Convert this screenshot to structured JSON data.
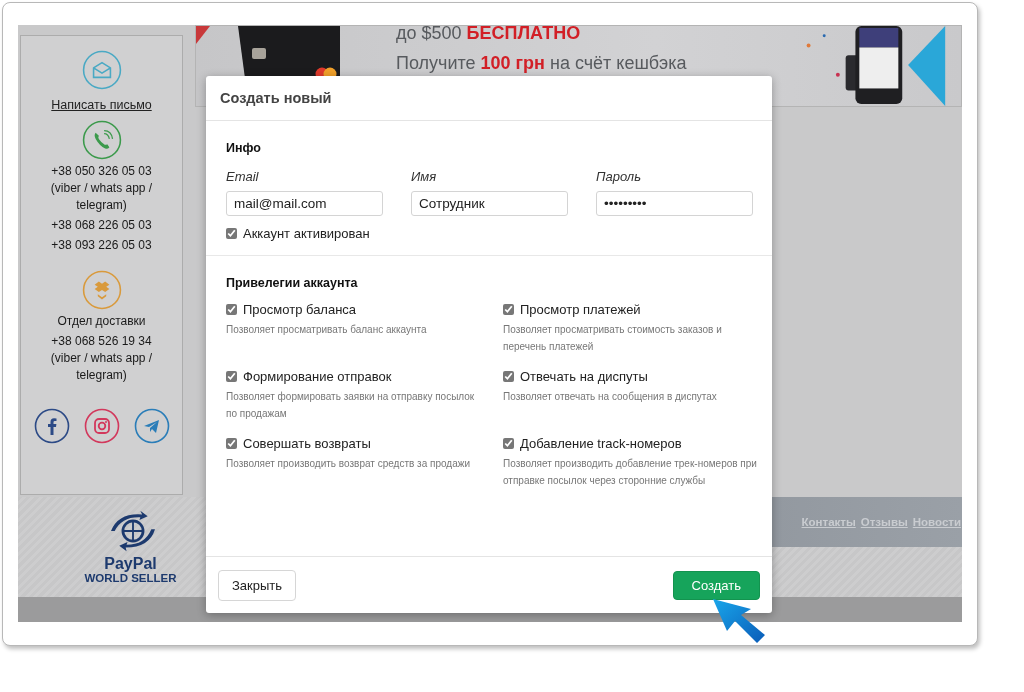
{
  "sidebar": {
    "write_link": "Написать письмо",
    "phones": [
      {
        "number": "+38 050 326 05 03",
        "note": "(viber / whats app / telegram)"
      },
      {
        "number": "+38 068 226 05 03"
      },
      {
        "number": "+38 093 226 05 03"
      }
    ],
    "delivery": {
      "title": "Отдел доставки",
      "number": "+38 068 526 19 34",
      "note": "(viber / whats app / telegram)"
    }
  },
  "banner": {
    "lines": [
      "до $500 **БЕСПЛАТНО**",
      "Получите **100 грн** на счёт кешбэка"
    ]
  },
  "footer": {
    "logo_title": "PayPal",
    "logo_subtitle": "WORLD SELLER",
    "links": [
      "Контакты",
      "Отзывы",
      "Новости"
    ]
  },
  "modal": {
    "title": "Создать новый",
    "info": {
      "heading": "Инфо",
      "fields": [
        {
          "label": "Email",
          "value": "mail@mail.com"
        },
        {
          "label": "Имя",
          "value": "Сотрудник"
        },
        {
          "label": "Пароль",
          "value": "•••••••••"
        }
      ],
      "active": {
        "label": "Аккаунт активирован",
        "checked": true
      }
    },
    "privileges": {
      "heading": "Привелегии аккаунта",
      "items": [
        {
          "label": "Просмотр баланса",
          "description": "Позволяет просматривать баланс аккаунта",
          "checked": true
        },
        {
          "label": "Просмотр платежей",
          "description": "Позволяет просматривать стоимость заказов и перечень платежей",
          "checked": true
        },
        {
          "label": "Формирование отправок",
          "description": "Позволяет формировать заявки на отправку посылок по продажам",
          "checked": true
        },
        {
          "label": "Отвечать на диспуты",
          "description": "Позволяет отвечать на сообщения в диспутах",
          "checked": true
        },
        {
          "label": "Совершать возвраты",
          "description": "Позволяет производить возврат средств за продажи",
          "checked": true
        },
        {
          "label": "Добавление track-номеров",
          "description": "Позволяет производить добавление трек-номеров при отправке посылок через сторонние службы",
          "checked": true
        }
      ]
    },
    "buttons": [
      {
        "kind": "secondary",
        "label": "Закрыть"
      },
      {
        "kind": "primary",
        "label": "Создать"
      }
    ]
  }
}
